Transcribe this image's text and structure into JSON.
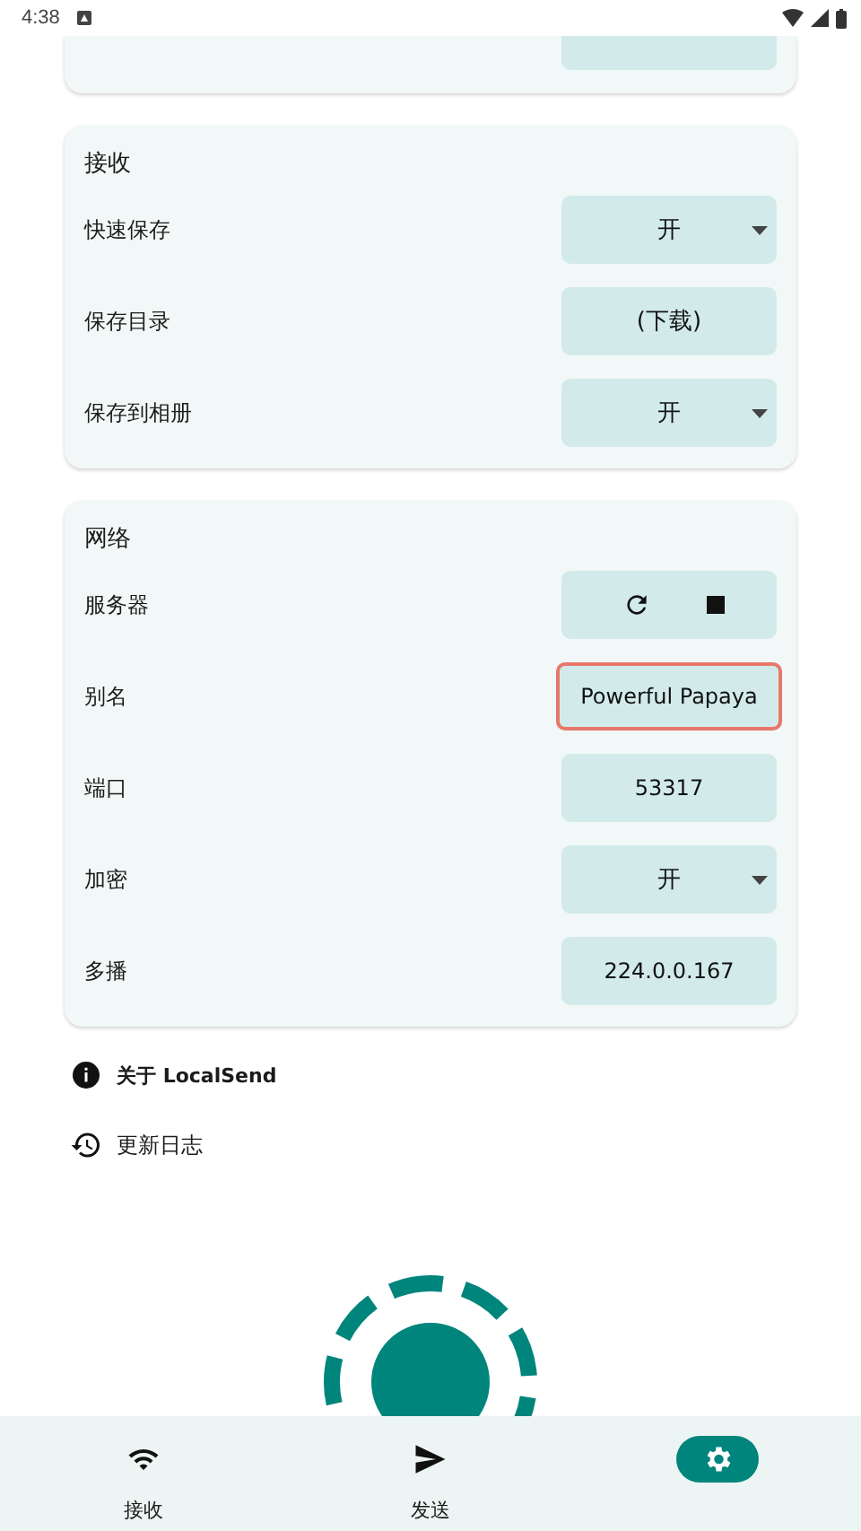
{
  "status_bar": {
    "time": "4:38"
  },
  "sections": [
    {
      "title": "接收",
      "rows": [
        {
          "label": "快速保存",
          "kind": "dropdown",
          "value": "开"
        },
        {
          "label": "保存目录",
          "kind": "button",
          "value": "(下载)"
        },
        {
          "label": "保存到相册",
          "kind": "dropdown",
          "value": "开"
        }
      ]
    },
    {
      "title": "网络",
      "rows": [
        {
          "label": "服务器",
          "kind": "server"
        },
        {
          "label": "别名",
          "kind": "field",
          "value": "Powerful Papaya",
          "focused": true
        },
        {
          "label": "端口",
          "kind": "field",
          "value": "53317",
          "focused": false
        },
        {
          "label": "加密",
          "kind": "dropdown",
          "value": "开"
        },
        {
          "label": "多播",
          "kind": "field",
          "value": "224.0.0.167",
          "focused": false
        }
      ]
    }
  ],
  "links": [
    {
      "kind": "info",
      "label": "关于 LocalSend"
    },
    {
      "kind": "history",
      "label": "更新日志"
    }
  ],
  "nav": [
    {
      "kind": "wifi",
      "label": "接收",
      "selected": false
    },
    {
      "kind": "send",
      "label": "发送",
      "selected": false
    },
    {
      "kind": "settings",
      "selected": true
    }
  ]
}
